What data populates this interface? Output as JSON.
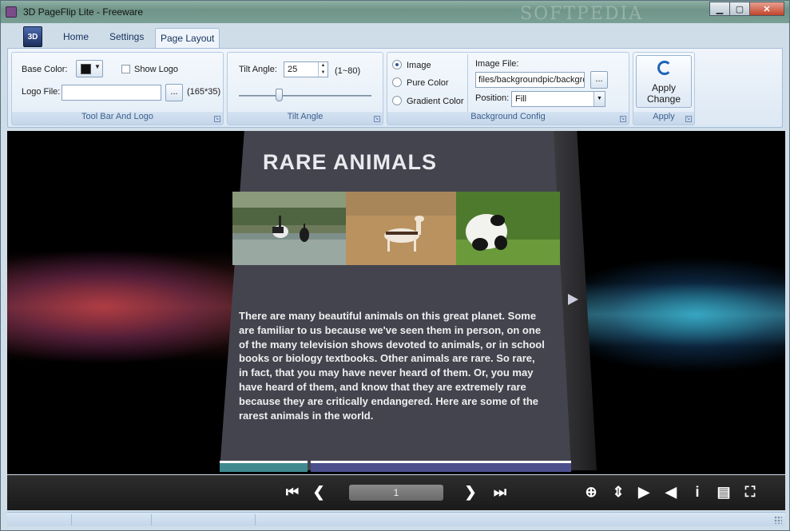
{
  "window": {
    "title": "3D PageFlip Lite - Freeware",
    "watermark": "SOFTPEDIA",
    "minimize": "▁",
    "maximize": "▢",
    "close": "✕"
  },
  "app_button": {
    "label": "3D"
  },
  "tabs": [
    {
      "label": "Home"
    },
    {
      "label": "Settings"
    },
    {
      "label": "Page Layout",
      "active": true
    }
  ],
  "toolbar_logo_group": {
    "base_color_label": "Base Color:",
    "base_color_value": "#111111",
    "show_logo_label": "Show Logo",
    "show_logo_checked": false,
    "logo_file_label": "Logo File:",
    "logo_file_value": "",
    "browse_label": "...",
    "size_hint": "(165*35)",
    "group_label": "Tool Bar And Logo"
  },
  "tilt_group": {
    "tilt_label": "Tilt Angle:",
    "tilt_value": "25",
    "range_hint": "(1~80)",
    "slider_fraction": 0.3,
    "group_label": "Tilt Angle"
  },
  "background_group": {
    "options": [
      {
        "label": "Image",
        "selected": true
      },
      {
        "label": "Pure Color",
        "selected": false
      },
      {
        "label": "Gradient Color",
        "selected": false
      }
    ],
    "image_file_label": "Image File:",
    "image_file_value": "files/backgroundpic/backgrc",
    "browse_label": "...",
    "position_label": "Position:",
    "position_value": "Fill",
    "group_label": "Background Config"
  },
  "apply_group": {
    "button_label_line1": "Apply",
    "button_label_line2": "Change",
    "group_label": "Apply"
  },
  "book_page": {
    "title": "RARE ANIMALS",
    "body": "There are many beautiful animals on this great planet.  Some are familiar to us because we've seen them in person, on one of the many television shows devoted to animals, or in school books or biology textbooks.  Other animals are rare.  So rare, in fact, that you may have never heard of them.  Or, you may have heard of them, and know that they are extremely rare because they are critically endangered.  Here are some of the rarest animals in the world."
  },
  "viewer_toolbar": {
    "page_number": "1",
    "icons": [
      "first-page-icon",
      "prev-page-icon",
      "next-page-icon",
      "last-page-icon",
      "zoom-in-icon",
      "fit-page-icon",
      "autoplay-icon",
      "sound-icon",
      "info-icon",
      "print-icon",
      "fullscreen-icon"
    ]
  },
  "colors": {
    "ribbon_bg": "#dce8f4",
    "group_label_text": "#3d5f8c",
    "page_bg": "#44444f",
    "glow_left": "#c83c50",
    "glow_right": "#28aad2"
  }
}
